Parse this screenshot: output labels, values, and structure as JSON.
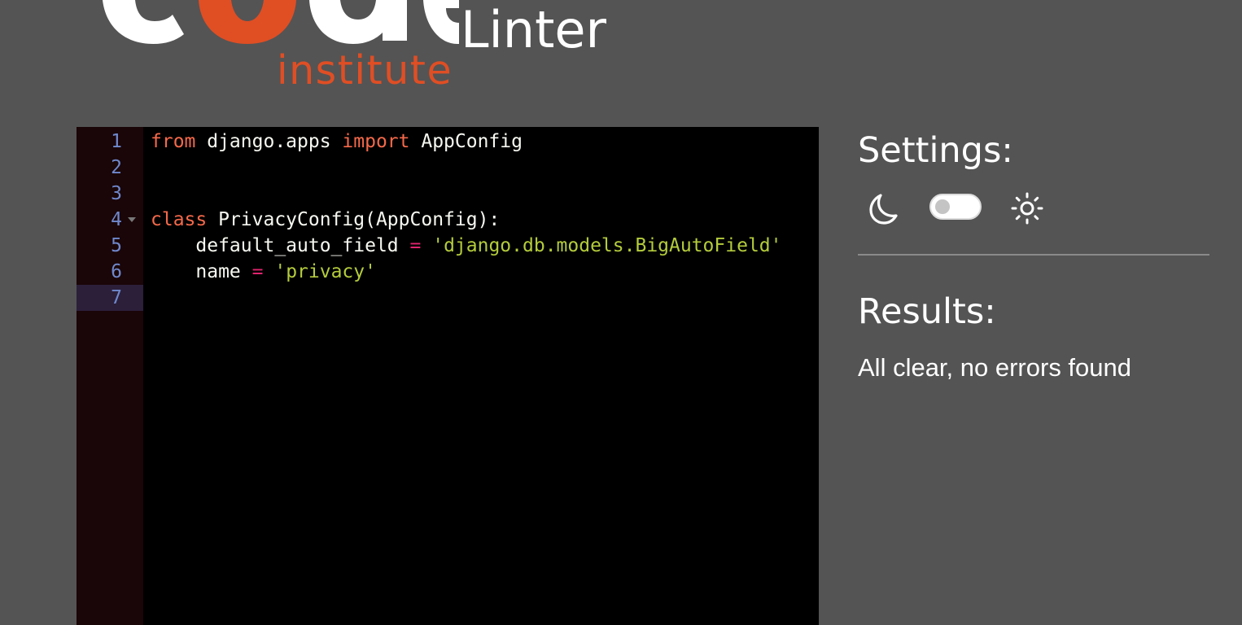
{
  "header": {
    "logo_primary_text": "code",
    "logo_secondary_text": "institute",
    "app_title": "Linter"
  },
  "editor": {
    "active_line": 7,
    "lines": [
      {
        "number": "1",
        "foldable": false,
        "tokens": [
          {
            "type": "kw",
            "text": "from"
          },
          {
            "type": "plain",
            "text": " django.apps "
          },
          {
            "type": "kw",
            "text": "import"
          },
          {
            "type": "plain",
            "text": " AppConfig"
          }
        ]
      },
      {
        "number": "2",
        "foldable": false,
        "tokens": []
      },
      {
        "number": "3",
        "foldable": false,
        "tokens": []
      },
      {
        "number": "4",
        "foldable": true,
        "tokens": [
          {
            "type": "kw",
            "text": "class"
          },
          {
            "type": "plain",
            "text": " PrivacyConfig(AppConfig):"
          }
        ]
      },
      {
        "number": "5",
        "foldable": false,
        "tokens": [
          {
            "type": "plain",
            "text": "    default_auto_field "
          },
          {
            "type": "op",
            "text": "="
          },
          {
            "type": "plain",
            "text": " "
          },
          {
            "type": "str",
            "text": "'django.db.models.BigAutoField'"
          }
        ]
      },
      {
        "number": "6",
        "foldable": false,
        "tokens": [
          {
            "type": "plain",
            "text": "    name "
          },
          {
            "type": "op",
            "text": "="
          },
          {
            "type": "plain",
            "text": " "
          },
          {
            "type": "str",
            "text": "'privacy'"
          }
        ]
      },
      {
        "number": "7",
        "foldable": false,
        "tokens": []
      }
    ]
  },
  "settings": {
    "heading": "Settings:",
    "dark_icon": "moon-icon",
    "light_icon": "sun-icon",
    "theme_toggle_on": false
  },
  "results": {
    "heading": "Results:",
    "message": "All clear, no errors found"
  },
  "colors": {
    "page_background": "#545454",
    "brand_orange": "#e04e24",
    "editor_background": "#000000",
    "keyword": "#f5694a",
    "operator": "#e0246e",
    "string": "#b4cc3c",
    "line_number": "#6f88cc"
  }
}
